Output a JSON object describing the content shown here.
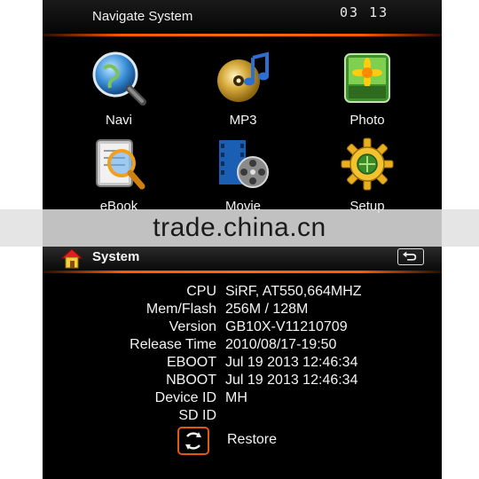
{
  "header": {
    "title": "Navigate System",
    "clock": "03 13"
  },
  "apps": [
    {
      "label": "Navi",
      "icon": "navi-globe-magnifier-icon"
    },
    {
      "label": "MP3",
      "icon": "mp3-disc-note-icon"
    },
    {
      "label": "Photo",
      "icon": "photo-sunflower-icon"
    },
    {
      "label": "eBook",
      "icon": "ebook-magnifier-icon"
    },
    {
      "label": "Movie",
      "icon": "movie-film-reel-icon"
    },
    {
      "label": "Setup",
      "icon": "setup-gear-icon"
    }
  ],
  "watermark": "trade.china.cn",
  "system": {
    "title": "System",
    "info": [
      {
        "key": "CPU",
        "value": "SiRF, AT550,664MHZ"
      },
      {
        "key": "Mem/Flash",
        "value": "256M / 128M"
      },
      {
        "key": "Version",
        "value": "GB10X-V11210709"
      },
      {
        "key": "Release Time",
        "value": "2010/08/17-19:50"
      },
      {
        "key": "EBOOT",
        "value": "Jul 19 2013 12:46:34"
      },
      {
        "key": "NBOOT",
        "value": "Jul 19 2013 12:46:34"
      },
      {
        "key": "Device ID",
        "value": "MH"
      },
      {
        "key": "SD ID",
        "value": ""
      }
    ],
    "restore_label": "Restore"
  },
  "colors": {
    "accent": "#ff5a00",
    "background": "#000000",
    "text": "#f4f4f4"
  }
}
